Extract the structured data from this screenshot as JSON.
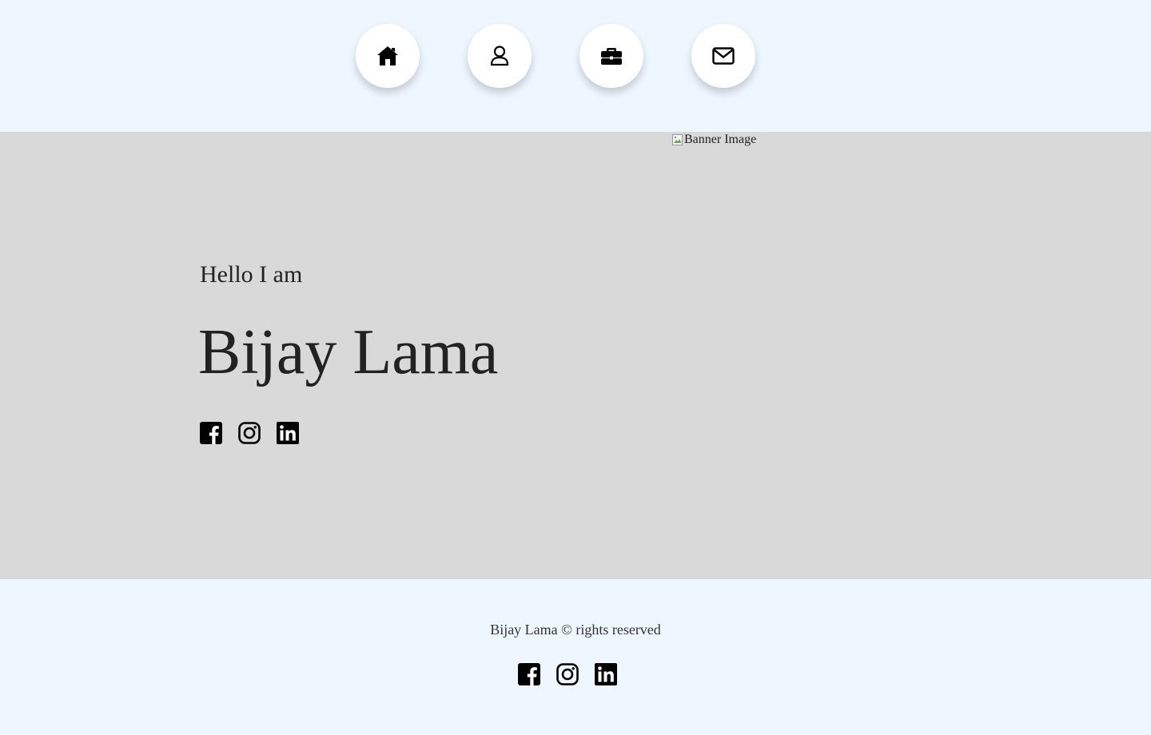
{
  "nav": {
    "items": [
      {
        "name": "home",
        "icon": "home-icon"
      },
      {
        "name": "about",
        "icon": "user-icon"
      },
      {
        "name": "work",
        "icon": "briefcase-icon"
      },
      {
        "name": "contact",
        "icon": "envelope-icon"
      }
    ]
  },
  "banner": {
    "image_alt": "Banner Image",
    "greeting": "Hello I am",
    "name": "Bijay Lama",
    "social": [
      {
        "name": "facebook",
        "icon": "facebook-icon"
      },
      {
        "name": "instagram",
        "icon": "instagram-icon"
      },
      {
        "name": "linkedin",
        "icon": "linkedin-icon"
      }
    ]
  },
  "footer": {
    "copyright": "Bijay Lama © rights reserved",
    "social": [
      {
        "name": "facebook",
        "icon": "facebook-icon"
      },
      {
        "name": "instagram",
        "icon": "instagram-icon"
      },
      {
        "name": "linkedin",
        "icon": "linkedin-icon"
      }
    ]
  },
  "colors": {
    "page_background": "#eef6ff",
    "banner_background": "#d9d9d9",
    "text": "#222222"
  }
}
